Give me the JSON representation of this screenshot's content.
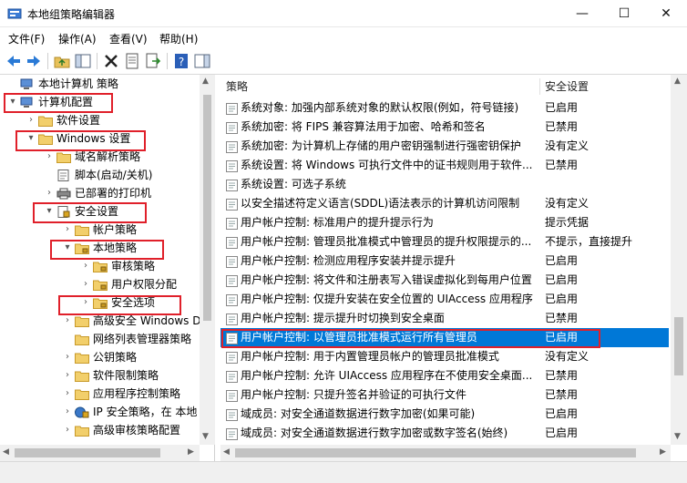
{
  "window": {
    "title": "本地组策略编辑器",
    "minimize": "—",
    "maximize": "☐",
    "close": "✕"
  },
  "menu": [
    {
      "label": "文件(F)"
    },
    {
      "label": "操作(A)"
    },
    {
      "label": "查看(V)"
    },
    {
      "label": "帮助(H)"
    }
  ],
  "tree": [
    {
      "label": "本地计算机 策略",
      "icon": "computer-icon"
    },
    {
      "label": "计算机配置",
      "icon": "computer-icon",
      "exp": "▾"
    },
    {
      "label": "软件设置",
      "icon": "folder-icon",
      "exp": "›"
    },
    {
      "label": "Windows 设置",
      "icon": "folder-icon",
      "exp": "▾"
    },
    {
      "label": "域名解析策略",
      "icon": "folder-icon",
      "exp": "›"
    },
    {
      "label": "脚本(启动/关机)",
      "icon": "script-icon",
      "exp": ""
    },
    {
      "label": "已部署的打印机",
      "icon": "printer-icon",
      "exp": "›"
    },
    {
      "label": "安全设置",
      "icon": "security-icon",
      "exp": "▾"
    },
    {
      "label": "帐户策略",
      "icon": "folder-icon",
      "exp": "›"
    },
    {
      "label": "本地策略",
      "icon": "folder-lock-icon",
      "exp": "▾"
    },
    {
      "label": "审核策略",
      "icon": "folder-lock-icon",
      "exp": "›"
    },
    {
      "label": "用户权限分配",
      "icon": "folder-lock-icon",
      "exp": "›"
    },
    {
      "label": "安全选项",
      "icon": "folder-lock-icon",
      "exp": "›"
    },
    {
      "label": "高级安全 Windows D",
      "icon": "folder-icon",
      "exp": "›"
    },
    {
      "label": "网络列表管理器策略",
      "icon": "folder-icon",
      "exp": ""
    },
    {
      "label": "公钥策略",
      "icon": "folder-icon",
      "exp": "›"
    },
    {
      "label": "软件限制策略",
      "icon": "folder-icon",
      "exp": "›"
    },
    {
      "label": "应用程序控制策略",
      "icon": "folder-icon",
      "exp": "›"
    },
    {
      "label": "IP 安全策略，在 本地",
      "icon": "ip-security-icon",
      "exp": "›"
    },
    {
      "label": "高级审核策略配置",
      "icon": "folder-icon",
      "exp": "›"
    }
  ],
  "list": {
    "columns": [
      "策略",
      "安全设置"
    ],
    "rows": [
      {
        "name": "系统对象: 加强内部系统对象的默认权限(例如，符号链接)",
        "value": "已启用"
      },
      {
        "name": "系统加密: 将 FIPS 兼容算法用于加密、哈希和签名",
        "value": "已禁用"
      },
      {
        "name": "系统加密: 为计算机上存储的用户密钥强制进行强密钥保护",
        "value": "没有定义"
      },
      {
        "name": "系统设置: 将 Windows 可执行文件中的证书规则用于软件...",
        "value": "已禁用"
      },
      {
        "name": "系统设置: 可选子系统",
        "value": ""
      },
      {
        "name": "以安全描述符定义语言(SDDL)语法表示的计算机访问限制",
        "value": "没有定义"
      },
      {
        "name": "用户帐户控制: 标准用户的提升提示行为",
        "value": "提示凭据"
      },
      {
        "name": "用户帐户控制: 管理员批准模式中管理员的提升权限提示的...",
        "value": "不提示，直接提升"
      },
      {
        "name": "用户帐户控制: 检测应用程序安装并提示提升",
        "value": "已启用"
      },
      {
        "name": "用户帐户控制: 将文件和注册表写入错误虚拟化到每用户位置",
        "value": "已启用"
      },
      {
        "name": "用户帐户控制: 仅提升安装在安全位置的 UIAccess 应用程序",
        "value": "已启用"
      },
      {
        "name": "用户帐户控制: 提示提升时切换到安全桌面",
        "value": "已禁用"
      },
      {
        "name": "用户帐户控制: 以管理员批准模式运行所有管理员",
        "value": "已启用"
      },
      {
        "name": "用户帐户控制: 用于内置管理员帐户的管理员批准模式",
        "value": "没有定义"
      },
      {
        "name": "用户帐户控制: 允许 UIAccess 应用程序在不使用安全桌面...",
        "value": "已禁用"
      },
      {
        "name": "用户帐户控制: 只提升签名并验证的可执行文件",
        "value": "已禁用"
      },
      {
        "name": "域成员: 对安全通道数据进行数字加密(如果可能)",
        "value": "已启用"
      },
      {
        "name": "域成员: 对安全通道数据进行数字加密或数字签名(始终)",
        "value": "已启用"
      }
    ]
  },
  "colors": {
    "selection": "#0078d7",
    "highlight_box": "#e0202a"
  }
}
